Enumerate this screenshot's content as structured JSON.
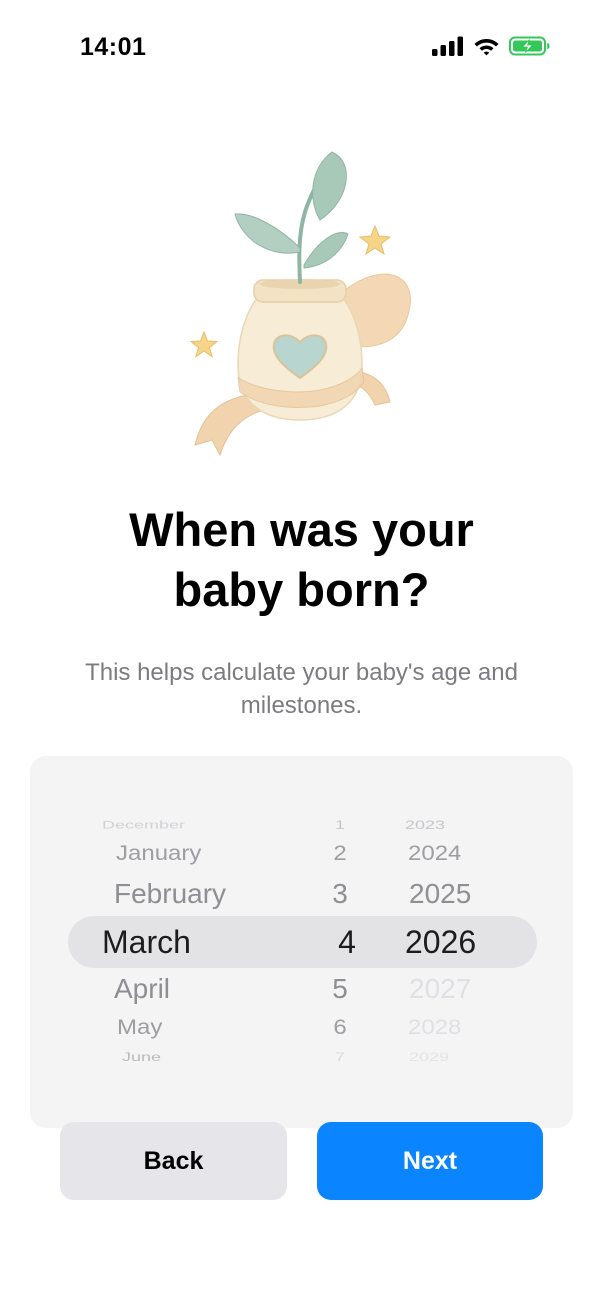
{
  "status_bar": {
    "time": "14:01",
    "icons": [
      "cellular-signal-icon",
      "wifi-icon",
      "battery-charging-icon"
    ],
    "battery_color": "#34c759"
  },
  "illustration": {
    "icon": "jar-with-sprout-and-heart-illustration"
  },
  "onboarding": {
    "title_line1": "When was your",
    "title_line2": "baby born?",
    "subtitle": "This helps calculate your baby's age and milestones."
  },
  "picker": {
    "months": [
      "December",
      "January",
      "February",
      "March",
      "April",
      "May",
      "June"
    ],
    "days": [
      "1",
      "2",
      "3",
      "4",
      "5",
      "6",
      "7"
    ],
    "years": [
      "2023",
      "2024",
      "2025",
      "2026",
      "2027",
      "2028",
      "2029"
    ],
    "selected": {
      "month": "March",
      "day": "4",
      "year": "2026"
    }
  },
  "actions": {
    "back_label": "Back",
    "next_label": "Next",
    "next_color": "#0a84ff"
  }
}
